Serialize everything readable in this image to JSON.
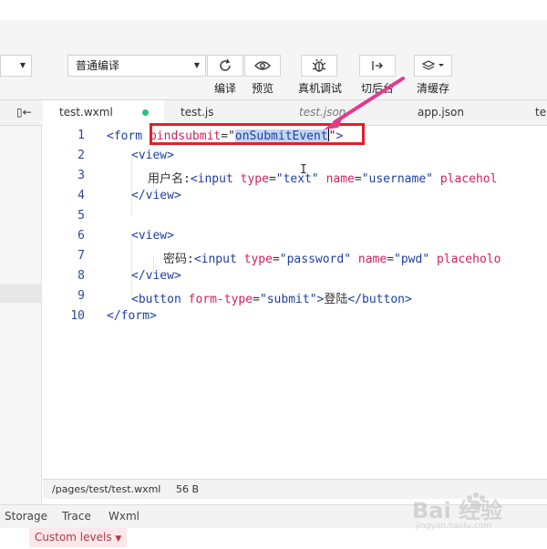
{
  "toolbar": {
    "mode_select": "普通编译",
    "buttons": [
      {
        "label": "编译",
        "icon": "refresh-icon"
      },
      {
        "label": "预览",
        "icon": "eye-icon"
      },
      {
        "label": "真机调试",
        "icon": "bug-icon"
      },
      {
        "label": "切后台",
        "icon": "switch-icon"
      },
      {
        "label": "清缓存",
        "icon": "layers-icon"
      }
    ]
  },
  "tabs": [
    {
      "label": "test.wxml",
      "active": true
    },
    {
      "label": "test.js"
    },
    {
      "label": "test.json",
      "italic": true
    },
    {
      "label": "app.json"
    },
    {
      "label": "te"
    }
  ],
  "editor": {
    "lines": [
      {
        "n": "1"
      },
      {
        "n": "2"
      },
      {
        "n": "3"
      },
      {
        "n": "4"
      },
      {
        "n": "5"
      },
      {
        "n": "6"
      },
      {
        "n": "7"
      },
      {
        "n": "8"
      },
      {
        "n": "9"
      },
      {
        "n": "10"
      }
    ],
    "code": {
      "form_open": "<form",
      "attr_bindsubmit": "bindsubmit",
      "bindsubmit_value": "onSubmitEvent",
      "gt": ">",
      "view_open": "<view>",
      "view_close": "</view>",
      "label_username": "用户名:",
      "label_password": "密码:",
      "input_tag": "<input",
      "attr_type": "type",
      "attr_name": "name",
      "attr_placeholder": "placehol",
      "attr_placeholder2": "placeholo",
      "type_text": "\"text\"",
      "name_username": "\"username\"",
      "type_password": "\"password\"",
      "name_pwd": "\"pwd\"",
      "button_open": "<button",
      "attr_formtype": "form-type",
      "formtype_value": "\"submit\"",
      "button_text": "登陆",
      "button_close": "</button>",
      "form_close": "</form>"
    }
  },
  "status": {
    "path": "/pages/test/test.wxml",
    "size": "56 B"
  },
  "panel_tabs": [
    "Storage",
    "Trace",
    "Wxml"
  ],
  "levels": "Custom levels",
  "watermark": {
    "text": "Bai 经验",
    "sub": "jingyan.baidu.com"
  },
  "colors": {
    "highlight_box": "#e0202a",
    "arrow": "#e23a8c",
    "selection": "#c3d6f2",
    "tab_dot": "#2bbf7f"
  }
}
